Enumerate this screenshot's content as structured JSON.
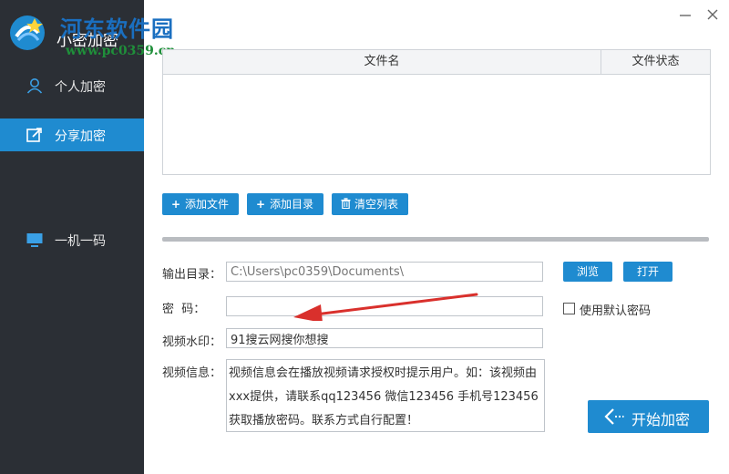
{
  "watermark": {
    "title": "河东软件园",
    "url": "www.pc0359.cn"
  },
  "app": {
    "title": "小密加密"
  },
  "window": {
    "minimize": "—",
    "close": "✕"
  },
  "sidebar": {
    "items": [
      {
        "label": "个人加密",
        "icon": "user-icon",
        "active": false
      },
      {
        "label": "分享加密",
        "icon": "share-edit-icon",
        "active": true
      },
      {
        "label": "一机一码",
        "icon": "monitor-icon",
        "active": false
      }
    ]
  },
  "table": {
    "columns": [
      "文件名",
      "文件状态"
    ],
    "rows": []
  },
  "actions": {
    "add_file": "添加文件",
    "add_dir": "添加目录",
    "clear_list": "清空列表"
  },
  "form": {
    "output_label": "输出目录：",
    "output_placeholder": "C:\\Users\\pc0359\\Documents\\",
    "browse": "浏览",
    "open": "打开",
    "password_label": "密  码：",
    "password_value": "",
    "use_default_password": "使用默认密码",
    "watermark_label": "视频水印：",
    "watermark_value": "91搜云网搜你想搜",
    "info_label": "视频信息：",
    "info_value": "视频信息会在播放视频请求授权时提示用户。如：该视频由xxx提供，请联系qq123456 微信123456 手机号123456 获取播放密码。联系方式自行配置！",
    "start": "开始加密"
  },
  "colors": {
    "accent": "#1f8bd0",
    "sidebar_bg": "#2b2f35",
    "annotation_arrow": "#d9302c"
  }
}
